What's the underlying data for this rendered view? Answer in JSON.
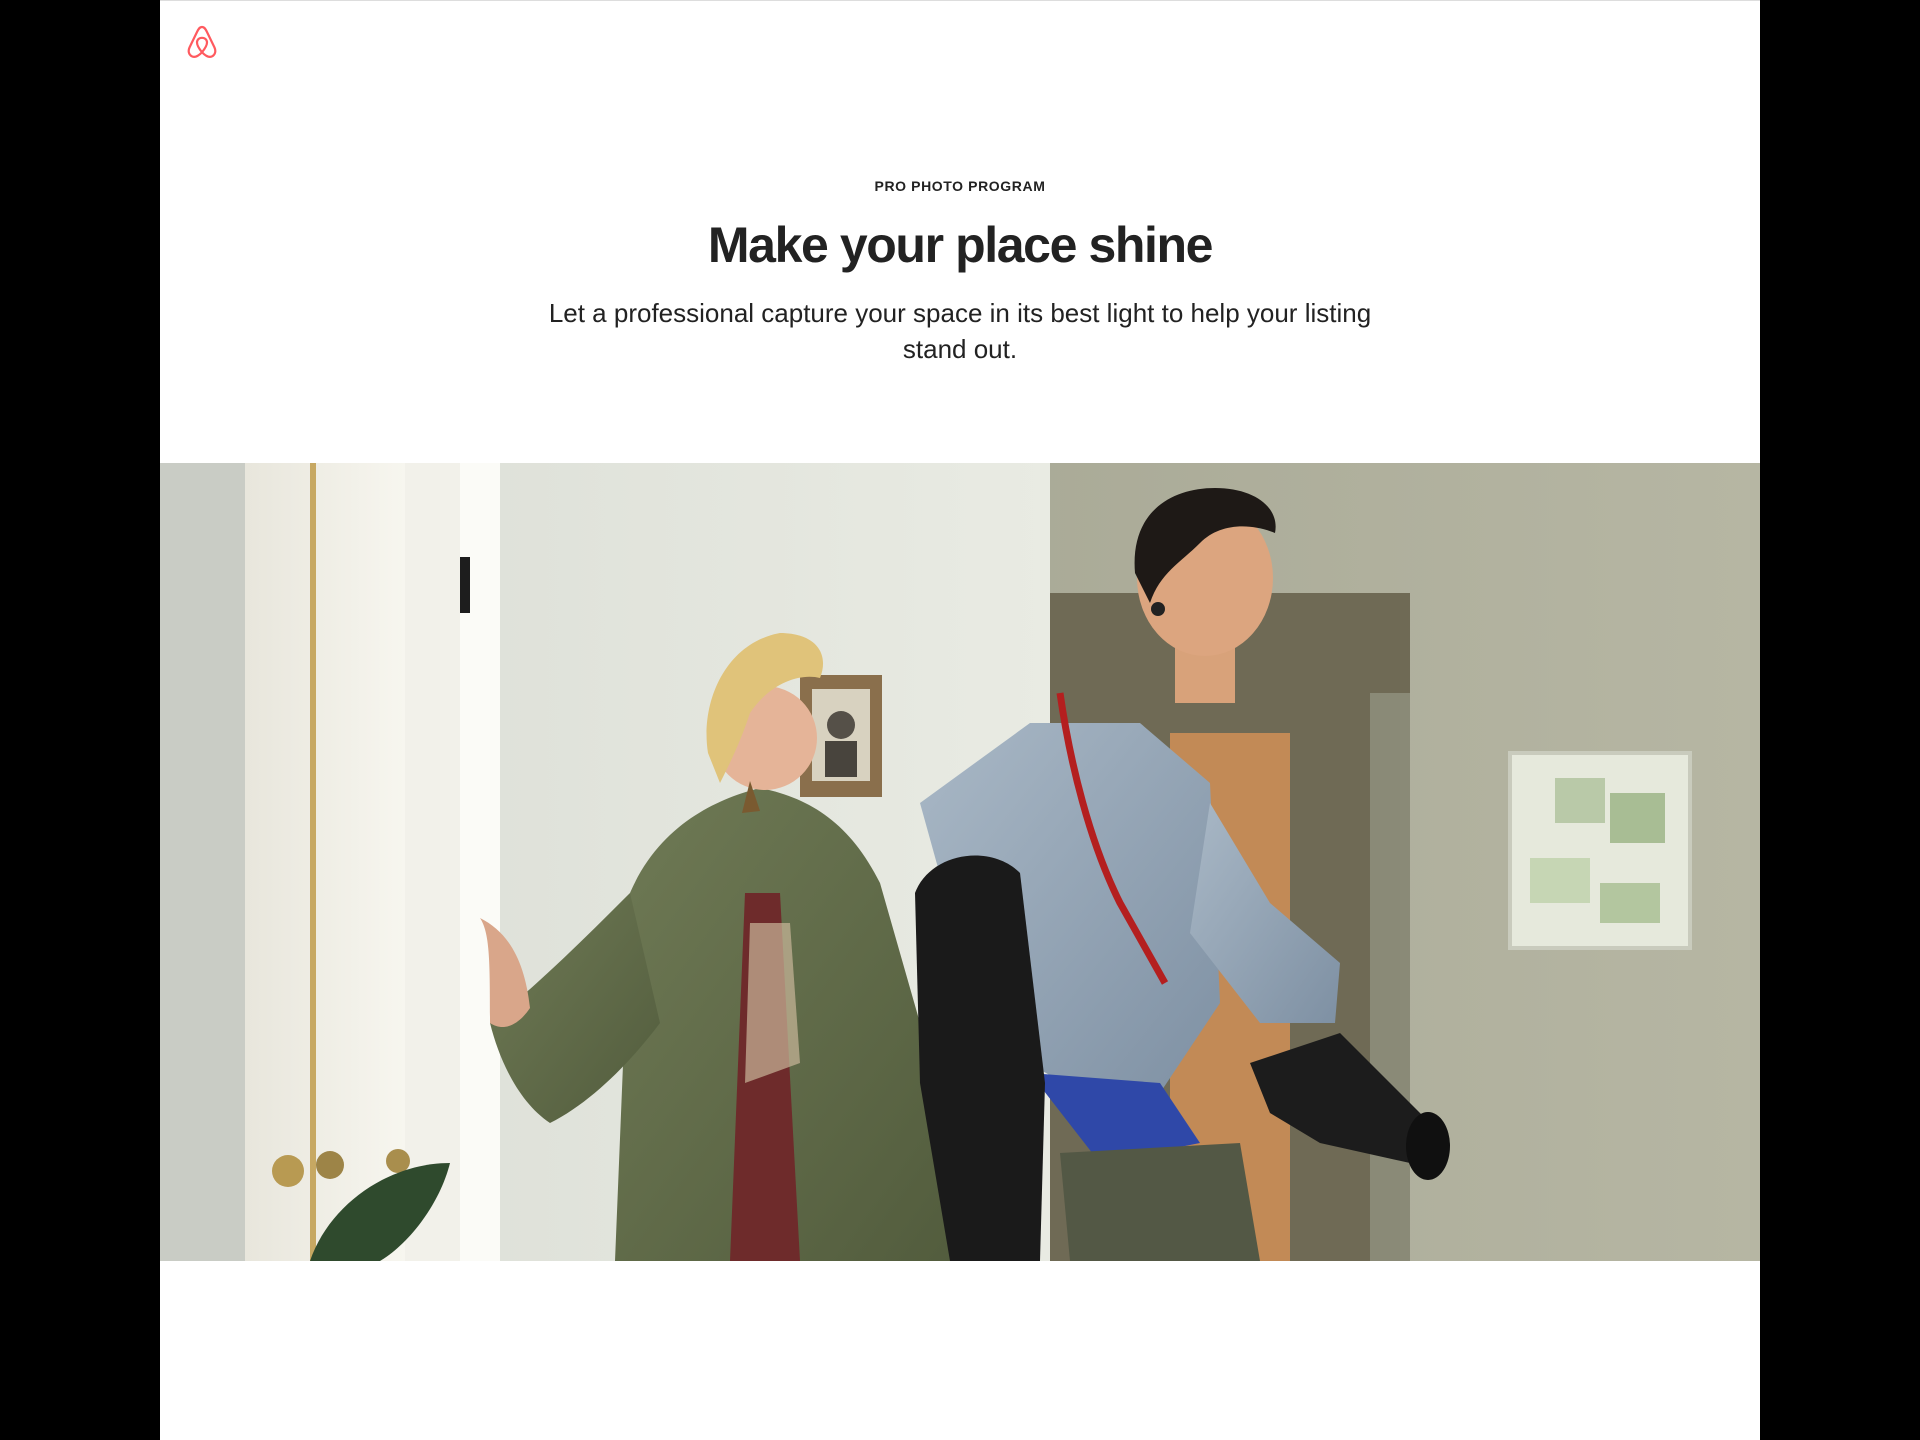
{
  "header": {
    "logo_name": "airbnb-logo",
    "brand_color": "#ff5a5f"
  },
  "hero": {
    "eyebrow": "PRO PHOTO PROGRAM",
    "title": "Make your place shine",
    "subtitle": "Let a professional capture your space in its best light to help your listing stand out."
  },
  "colors": {
    "text": "#222222",
    "background": "#ffffff",
    "letterbox": "#000000"
  }
}
